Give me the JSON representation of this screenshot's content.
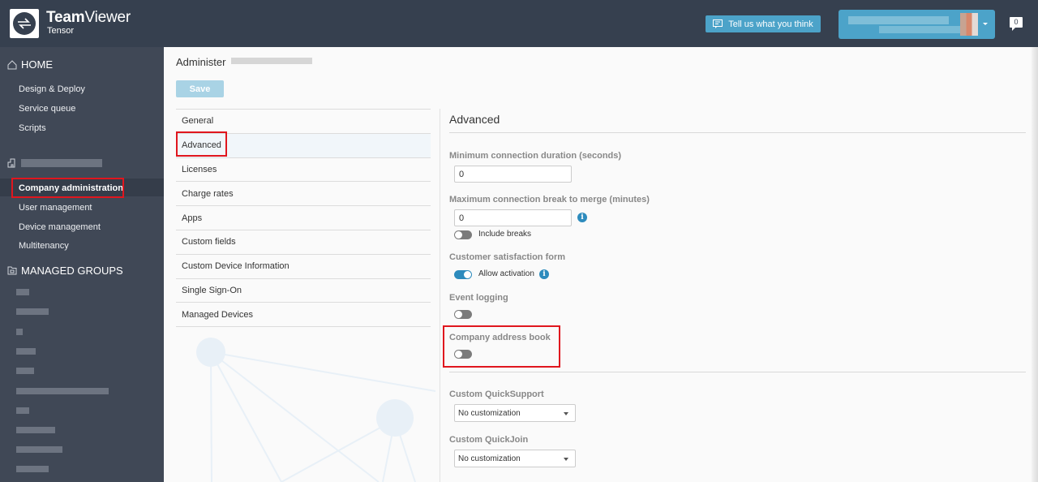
{
  "header": {
    "brand_bold": "Team",
    "brand_rest": "Viewer",
    "brand_sub": "Tensor",
    "feedback_label": "Tell us what you think",
    "notification_count": "0",
    "accent_color": "#4ca3c9"
  },
  "sidebar": {
    "home_label": "HOME",
    "home_items": [
      "Design & Deploy",
      "Service queue",
      "Scripts"
    ],
    "company_items": [
      "Company administration",
      "User management",
      "Device management",
      "Multitenancy"
    ],
    "active_item": "Company administration",
    "managed_groups_label": "MANAGED GROUPS"
  },
  "main": {
    "title": "Administer",
    "save_label": "Save",
    "nav": [
      "General",
      "Advanced",
      "Licenses",
      "Charge rates",
      "Apps",
      "Custom fields",
      "Custom Device Information",
      "Single Sign-On",
      "Managed Devices"
    ],
    "selected_nav": "Advanced"
  },
  "panel": {
    "title": "Advanced",
    "min_duration_label": "Minimum connection duration (seconds)",
    "min_duration_value": "0",
    "max_break_label": "Maximum connection break to merge (minutes)",
    "max_break_value": "0",
    "include_breaks_label": "Include breaks",
    "include_breaks_on": false,
    "satisfaction_label": "Customer satisfaction form",
    "allow_activation_label": "Allow activation",
    "allow_activation_on": true,
    "event_logging_label": "Event logging",
    "event_logging_on": false,
    "address_book_label": "Company address book",
    "address_book_on": false,
    "quicksupport_label": "Custom QuickSupport",
    "quicksupport_value": "No customization",
    "quickjoin_label": "Custom QuickJoin",
    "quickjoin_value": "No customization"
  }
}
